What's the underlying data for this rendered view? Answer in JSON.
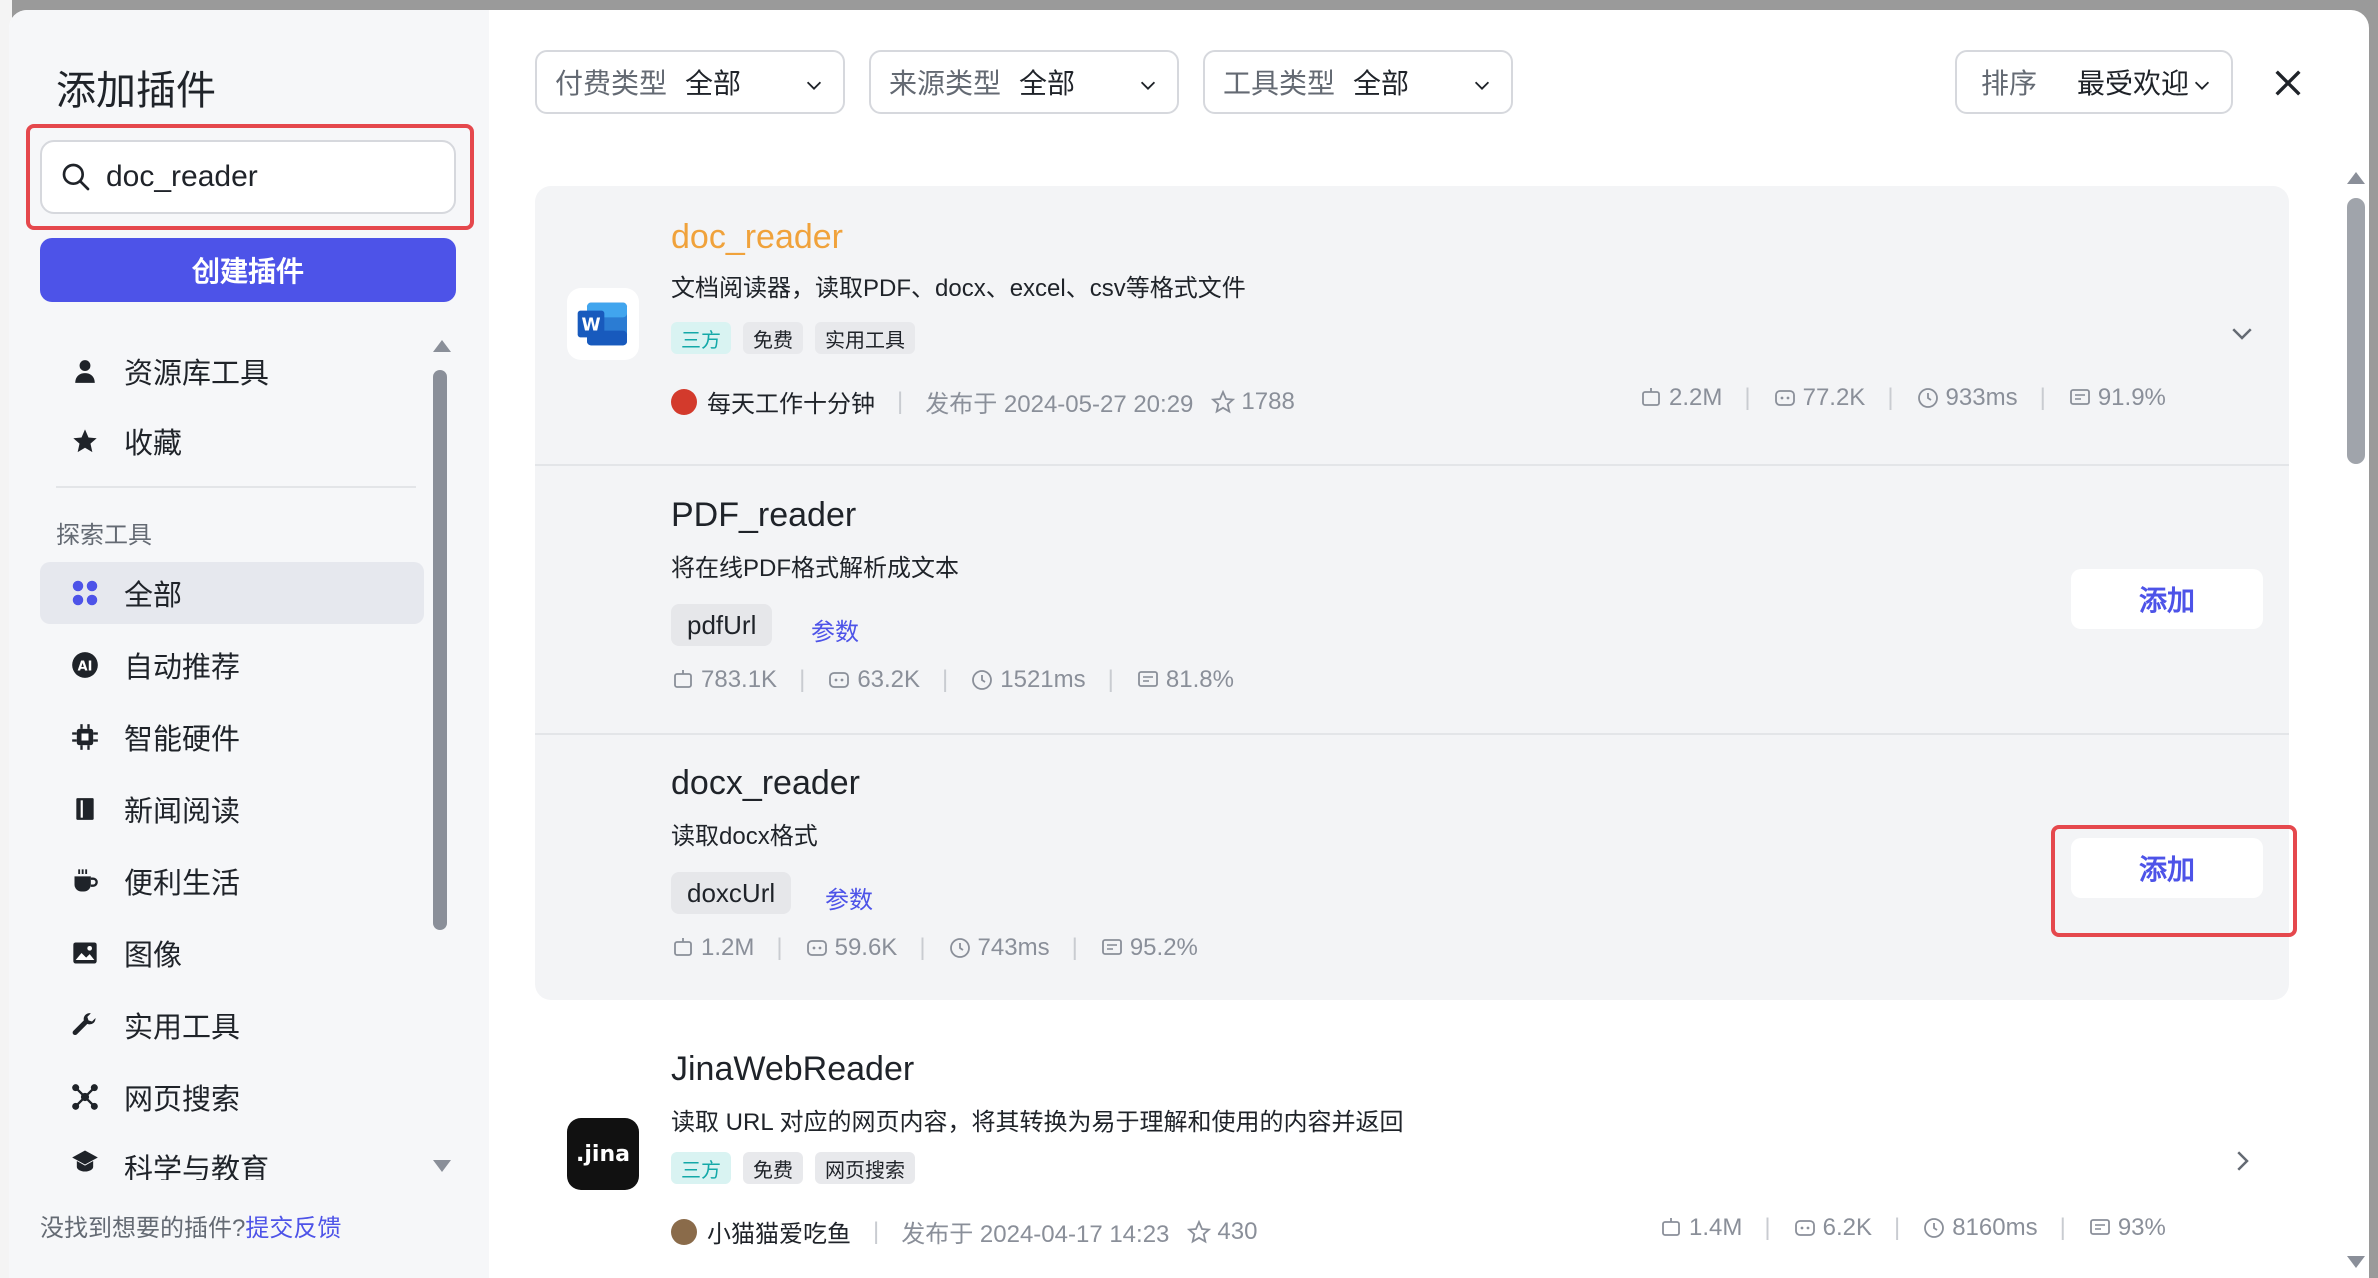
{
  "sidebar": {
    "title": "添加插件",
    "search": {
      "value": "doc_reader"
    },
    "create_label": "创建插件",
    "top_items": [
      {
        "label": "资源库工具"
      },
      {
        "label": "收藏"
      }
    ],
    "section_label": "探索工具",
    "categories": [
      {
        "label": "全部",
        "active": true
      },
      {
        "label": "自动推荐"
      },
      {
        "label": "智能硬件"
      },
      {
        "label": "新闻阅读"
      },
      {
        "label": "便利生活"
      },
      {
        "label": "图像"
      },
      {
        "label": "实用工具"
      },
      {
        "label": "网页搜索"
      },
      {
        "label": "科学与教育"
      }
    ],
    "footer_text": "没找到想要的插件?",
    "footer_link": "提交反馈"
  },
  "filters": {
    "pay": {
      "key": "付费类型",
      "value": "全部"
    },
    "source": {
      "key": "来源类型",
      "value": "全部"
    },
    "tool": {
      "key": "工具类型",
      "value": "全部"
    },
    "sort": {
      "key": "排序",
      "value": "最受欢迎"
    }
  },
  "plugins": [
    {
      "name": "doc_reader",
      "desc": "文档阅读器，读取PDF、docx、excel、csv等格式文件",
      "tags": [
        "三方",
        "免费",
        "实用工具"
      ],
      "author": "每天工作十分钟",
      "published": "发布于 2024-05-27 20:29",
      "stars": "1788",
      "calls": "2.2M",
      "bots": "77.2K",
      "latency": "933ms",
      "success": "91.9%"
    },
    {
      "name": "PDF_reader",
      "desc": "将在线PDF格式解析成文本",
      "param": "pdfUrl",
      "param_link": "参数",
      "calls": "783.1K",
      "bots": "63.2K",
      "latency": "1521ms",
      "success": "81.8%",
      "add_label": "添加"
    },
    {
      "name": "docx_reader",
      "desc": "读取docx格式",
      "param": "doxcUrl",
      "param_link": "参数",
      "calls": "1.2M",
      "bots": "59.6K",
      "latency": "743ms",
      "success": "95.2%",
      "add_label": "添加"
    },
    {
      "name": "JinaWebReader",
      "desc": "读取 URL 对应的网页内容，将其转换为易于理解和使用的内容并返回",
      "tags": [
        "三方",
        "免费",
        "网页搜索"
      ],
      "author": "小猫猫爱吃鱼",
      "published": "发布于 2024-04-17 14:23",
      "stars": "430",
      "calls": "1.4M",
      "bots": "6.2K",
      "latency": "8160ms",
      "success": "93%"
    }
  ],
  "colors": {
    "accent": "#4d53e8",
    "highlight": "#e5484d",
    "title_orange": "#f0a23b"
  },
  "icons": {
    "word": "W",
    "jina": ".jina"
  }
}
